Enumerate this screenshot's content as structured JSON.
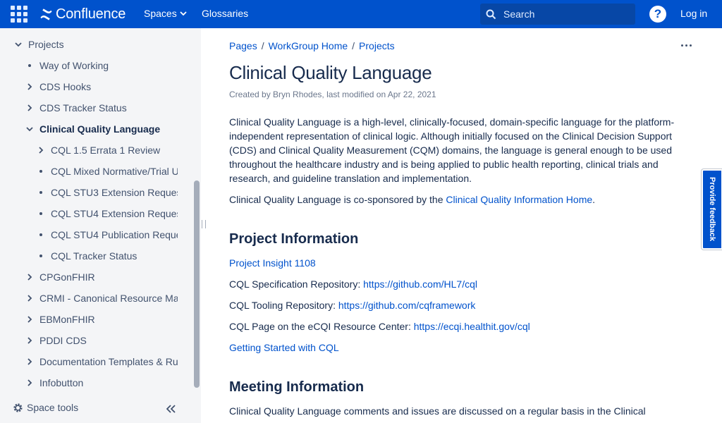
{
  "colors": {
    "header_bg": "#0052cc",
    "link": "#0052cc",
    "sidebar_bg": "#f4f5f7",
    "text": "#172b4d"
  },
  "header": {
    "app_switcher_icon": "grid-icon",
    "logo_text": "Confluence",
    "nav_spaces": "Spaces",
    "nav_glossaries": "Glossaries",
    "search_placeholder": "Search",
    "help_icon": "question-icon",
    "login": "Log in"
  },
  "sidebar": {
    "items": [
      {
        "label": "Projects",
        "marker": "expanded"
      },
      {
        "label": "Way of Working",
        "marker": "bullet"
      },
      {
        "label": "CDS Hooks",
        "marker": "collapsed"
      },
      {
        "label": "CDS Tracker Status",
        "marker": "collapsed"
      },
      {
        "label": "Clinical Quality Language",
        "marker": "expanded"
      },
      {
        "label": "CQL 1.5 Errata 1 Review",
        "marker": "collapsed"
      },
      {
        "label": "CQL Mixed Normative/Trial U",
        "marker": "bullet"
      },
      {
        "label": "CQL STU3 Extension Reques",
        "marker": "bullet"
      },
      {
        "label": "CQL STU4 Extension Reques",
        "marker": "bullet"
      },
      {
        "label": "CQL STU4 Publication Reque",
        "marker": "bullet"
      },
      {
        "label": "CQL Tracker Status",
        "marker": "bullet"
      },
      {
        "label": "CPGonFHIR",
        "marker": "collapsed"
      },
      {
        "label": "CRMI - Canonical Resource Ma",
        "marker": "collapsed"
      },
      {
        "label": "EBMonFHIR",
        "marker": "collapsed"
      },
      {
        "label": "PDDI CDS",
        "marker": "collapsed"
      },
      {
        "label": "Documentation Templates & Ru",
        "marker": "collapsed"
      },
      {
        "label": "Infobutton",
        "marker": "collapsed"
      }
    ],
    "space_tools": "Space tools"
  },
  "breadcrumb": [
    "Pages",
    "WorkGroup Home",
    "Projects"
  ],
  "page": {
    "title": "Clinical Quality Language",
    "byline": "Created by Bryn Rhodes, last modified on Apr 22, 2021",
    "intro": "Clinical Quality Language is a high-level, clinically-focused, domain-specific language for the platform-independent representation of clinical logic. Although initially focused on the Clinical Decision Support (CDS) and Clinical Quality Measurement (CQM) domains, the language is general enough to be used throughout the healthcare industry and is being applied to public health reporting, clinical trials and research, and guideline translation and implementation.",
    "cosponsor_prefix": "Clinical Quality Language is co-sponsored by the ",
    "cosponsor_link": "Clinical Quality Information Home",
    "cosponsor_suffix": ".",
    "project_heading": "Project Information",
    "project_insight": "Project Insight 1108",
    "spec_label": "CQL Specification Repository: ",
    "spec_link": "https://github.com/HL7/cql",
    "tooling_label": "CQL Tooling Repository: ",
    "tooling_link": "https://github.com/cqframework",
    "ecqi_label": "CQL Page on the eCQI Resource Center: ",
    "ecqi_link": "https://ecqi.healthit.gov/cql",
    "getting_started": "Getting Started with CQL",
    "meeting_heading": "Meeting Information",
    "meeting_text": "Clinical Quality Language comments and issues are discussed on a regular basis in the Clinical"
  },
  "feedback": "Provide feedback"
}
